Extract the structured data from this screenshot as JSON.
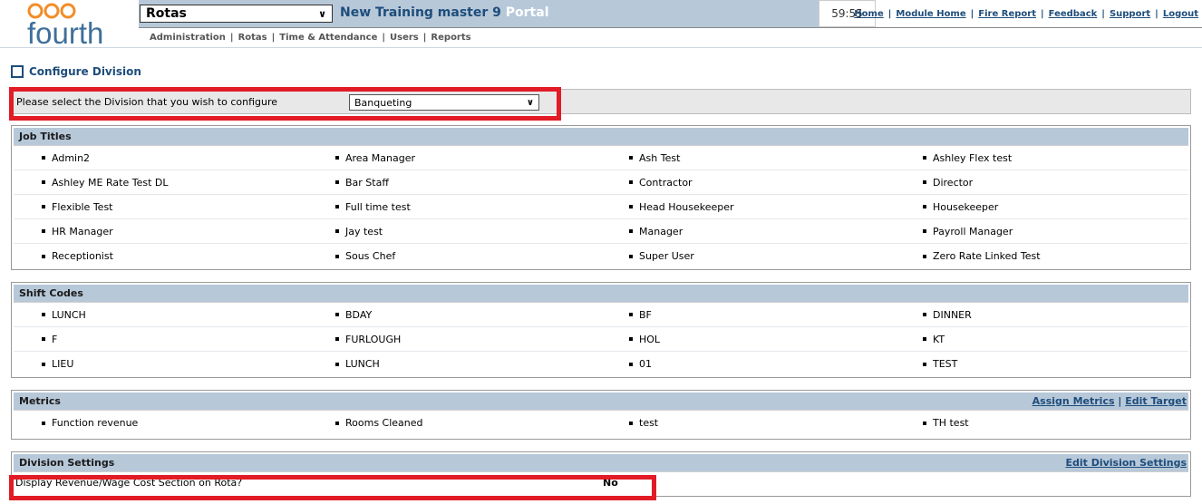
{
  "header": {
    "brand": "fourth",
    "module": "Rotas",
    "portal_name": "New Training master 9",
    "portal_suffix": "Portal",
    "timer": "59:55",
    "links": [
      "Home",
      "Module Home",
      "Fire Report",
      "Feedback",
      "Support",
      "Logout"
    ],
    "nav": [
      "Administration",
      "Rotas",
      "Time & Attendance",
      "Users",
      "Reports"
    ]
  },
  "page": {
    "title": "Configure Division",
    "select_label": "Please select the Division that you wish to configure",
    "division_value": "Banqueting"
  },
  "job_titles": {
    "title": "Job Titles",
    "rows": [
      [
        "Admin2",
        "Area Manager",
        "Ash Test",
        "Ashley Flex test"
      ],
      [
        "Ashley ME Rate Test DL",
        "Bar Staff",
        "Contractor",
        "Director"
      ],
      [
        "Flexible Test",
        "Full time test",
        "Head Housekeeper",
        "Housekeeper"
      ],
      [
        "HR Manager",
        "Jay test",
        "Manager",
        "Payroll Manager"
      ],
      [
        "Receptionist",
        "Sous Chef",
        "Super User",
        "Zero Rate Linked Test"
      ]
    ]
  },
  "shift_codes": {
    "title": "Shift Codes",
    "rows": [
      [
        "LUNCH",
        "BDAY",
        "BF",
        "DINNER"
      ],
      [
        "F",
        "FURLOUGH",
        "HOL",
        "KT"
      ],
      [
        "LIEU",
        "LUNCH",
        "01",
        "TEST"
      ]
    ]
  },
  "metrics": {
    "title": "Metrics",
    "assign_link": "Assign Metrics",
    "edit_target_link": "Edit Target",
    "rows": [
      [
        "Function revenue",
        "Rooms Cleaned",
        "test",
        "TH test"
      ]
    ]
  },
  "division_settings": {
    "title": "Division Settings",
    "edit_link": "Edit Division Settings",
    "question": "Display Revenue/Wage Cost Section on Rota?",
    "answer": "No"
  },
  "colors": {
    "band": "#b7c8d9",
    "brand_blue": "#1e4d7b",
    "highlight_red": "#e21b26"
  }
}
